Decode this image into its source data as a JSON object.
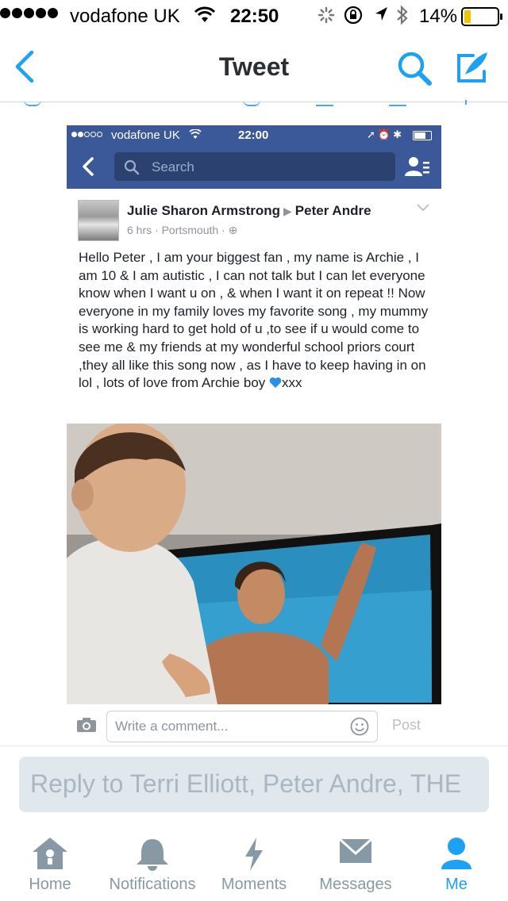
{
  "status_bar": {
    "carrier": "vodafone UK",
    "time": "22:50",
    "battery": "14%"
  },
  "nav": {
    "title": "Tweet"
  },
  "embedded_facebook": {
    "status": {
      "carrier": "vodafone UK",
      "time": "22:00"
    },
    "search_placeholder": "Search",
    "post": {
      "author": "Julie Sharon Armstrong",
      "recipient": "Peter Andre",
      "time_ago": "6 hrs",
      "location": "Portsmouth",
      "text": "Hello Peter , I am your biggest fan , my name is Archie , I am 10 & I am autistic , I can not talk but I can let everyone know when I want u on , & when I want it on repeat !! Now everyone in my family loves my favorite song , my mummy is working hard to get hold of u ,to see if u  would come to see me & my friends at my wonderful school priors court ,they all like this song now , as I have to keep having in on lol , lots of love from Archie boy ",
      "text_end": "xxx"
    },
    "comment_placeholder": "Write a comment...",
    "post_button": "Post"
  },
  "reply": {
    "placeholder": "Reply to Terri Elliott, Peter Andre, THE"
  },
  "tabs": [
    {
      "label": "Home",
      "icon": "home-icon"
    },
    {
      "label": "Notifications",
      "icon": "bell-icon"
    },
    {
      "label": "Moments",
      "icon": "lightning-icon"
    },
    {
      "label": "Messages",
      "icon": "envelope-icon"
    },
    {
      "label": "Me",
      "icon": "person-icon",
      "active": true
    }
  ],
  "colors": {
    "twitter_blue": "#1da1f2",
    "facebook_blue": "#3b5998",
    "tab_inactive": "#8899a6"
  }
}
